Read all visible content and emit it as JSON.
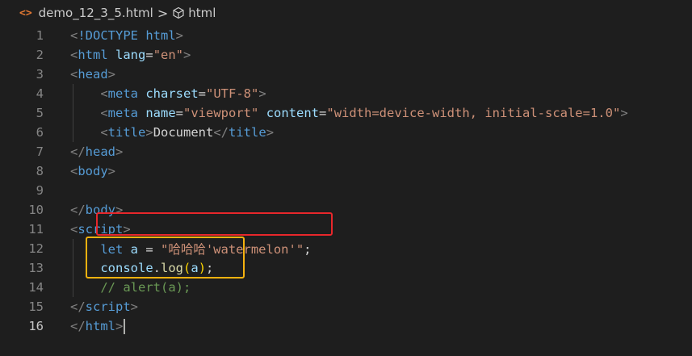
{
  "breadcrumb": {
    "file_icon": "<>",
    "file_name": "demo_12_3_5.html",
    "separator": ">",
    "symbol_icon": "html-tag-symbol-icon",
    "symbol_name": "html"
  },
  "colors": {
    "background": "#1e1e1e",
    "tag": "#569cd6",
    "attribute": "#9cdcfe",
    "string": "#ce9178",
    "comment": "#6a9955",
    "function": "#dcdcaa",
    "highlight_red": "#e8272b",
    "highlight_yellow": "#f5b20f"
  },
  "editor": {
    "active_line": 16,
    "lines": [
      {
        "num": "1",
        "tokens": [
          [
            "bracket",
            "<"
          ],
          [
            "tag",
            "!DOCTYPE"
          ],
          [
            "text",
            " "
          ],
          [
            "tag",
            "html"
          ],
          [
            "bracket",
            ">"
          ]
        ]
      },
      {
        "num": "2",
        "tokens": [
          [
            "bracket",
            "<"
          ],
          [
            "tag",
            "html"
          ],
          [
            "text",
            " "
          ],
          [
            "attr",
            "lang"
          ],
          [
            "text",
            "="
          ],
          [
            "str",
            "\"en\""
          ],
          [
            "bracket",
            ">"
          ]
        ]
      },
      {
        "num": "3",
        "tokens": [
          [
            "bracket",
            "<"
          ],
          [
            "tag",
            "head"
          ],
          [
            "bracket",
            ">"
          ]
        ]
      },
      {
        "num": "4",
        "tokens": [
          [
            "text",
            "    "
          ],
          [
            "bracket",
            "<"
          ],
          [
            "tag",
            "meta"
          ],
          [
            "text",
            " "
          ],
          [
            "attr",
            "charset"
          ],
          [
            "text",
            "="
          ],
          [
            "str",
            "\"UTF-8\""
          ],
          [
            "bracket",
            ">"
          ]
        ]
      },
      {
        "num": "5",
        "tokens": [
          [
            "text",
            "    "
          ],
          [
            "bracket",
            "<"
          ],
          [
            "tag",
            "meta"
          ],
          [
            "text",
            " "
          ],
          [
            "attr",
            "name"
          ],
          [
            "text",
            "="
          ],
          [
            "str",
            "\"viewport\""
          ],
          [
            "text",
            " "
          ],
          [
            "attr",
            "content"
          ],
          [
            "text",
            "="
          ],
          [
            "str",
            "\"width=device-width, initial-scale=1.0\""
          ],
          [
            "bracket",
            ">"
          ]
        ]
      },
      {
        "num": "6",
        "tokens": [
          [
            "text",
            "    "
          ],
          [
            "bracket",
            "<"
          ],
          [
            "tag",
            "title"
          ],
          [
            "bracket",
            ">"
          ],
          [
            "text",
            "Document"
          ],
          [
            "bracket",
            "</"
          ],
          [
            "tag",
            "title"
          ],
          [
            "bracket",
            ">"
          ]
        ]
      },
      {
        "num": "7",
        "tokens": [
          [
            "bracket",
            "</"
          ],
          [
            "tag",
            "head"
          ],
          [
            "bracket",
            ">"
          ]
        ]
      },
      {
        "num": "8",
        "tokens": [
          [
            "bracket",
            "<"
          ],
          [
            "tag",
            "body"
          ],
          [
            "bracket",
            ">"
          ]
        ]
      },
      {
        "num": "9",
        "tokens": []
      },
      {
        "num": "10",
        "tokens": [
          [
            "bracket",
            "</"
          ],
          [
            "tag",
            "body"
          ],
          [
            "bracket",
            ">"
          ]
        ]
      },
      {
        "num": "11",
        "tokens": [
          [
            "bracket",
            "<"
          ],
          [
            "tag",
            "script"
          ],
          [
            "bracket",
            ">"
          ]
        ]
      },
      {
        "num": "12",
        "tokens": [
          [
            "text",
            "    "
          ],
          [
            "kw",
            "let"
          ],
          [
            "text",
            " "
          ],
          [
            "var",
            "a"
          ],
          [
            "text",
            " = "
          ],
          [
            "str",
            "\"哈哈哈'watermelon'\""
          ],
          [
            "text",
            ";"
          ]
        ]
      },
      {
        "num": "13",
        "tokens": [
          [
            "text",
            "    "
          ],
          [
            "var",
            "console"
          ],
          [
            "text",
            "."
          ],
          [
            "fn",
            "log"
          ],
          [
            "paren",
            "("
          ],
          [
            "var",
            "a"
          ],
          [
            "paren",
            ")"
          ],
          [
            "text",
            ";"
          ]
        ]
      },
      {
        "num": "14",
        "tokens": [
          [
            "text",
            "    "
          ],
          [
            "comment",
            "// alert(a);"
          ]
        ]
      },
      {
        "num": "15",
        "tokens": [
          [
            "bracket",
            "</"
          ],
          [
            "tag",
            "script"
          ],
          [
            "bracket",
            ">"
          ]
        ]
      },
      {
        "num": "16",
        "tokens": [
          [
            "bracket",
            "</"
          ],
          [
            "tag",
            "html"
          ],
          [
            "bracket",
            ">"
          ]
        ]
      }
    ]
  }
}
